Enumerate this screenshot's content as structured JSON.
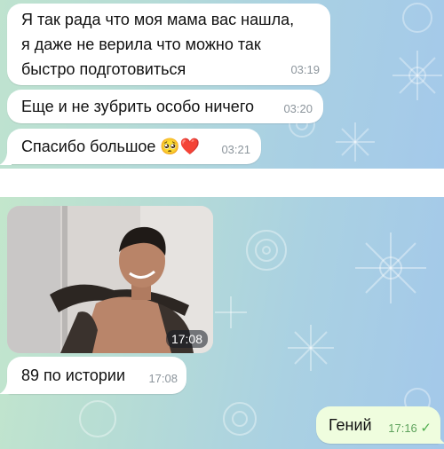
{
  "top_chat": {
    "messages": [
      {
        "lines": [
          "Я так рада что моя мама вас нашла,",
          "я даже не верила что можно так",
          "быстро подготовиться"
        ],
        "time": "03:19"
      },
      {
        "text": "Еще и не зубрить особо ничего",
        "time": "03:20"
      },
      {
        "text": "Спасибо большое",
        "emoji": "🥺❤️",
        "time": "03:21"
      }
    ]
  },
  "bottom_chat": {
    "gif": {
      "duration": "17:08"
    },
    "messages": [
      {
        "text": "89 по истории",
        "time": "17:08"
      }
    ],
    "outgoing": {
      "text": "Гений",
      "time": "17:16",
      "status_icon": "check-icon"
    }
  },
  "colors": {
    "incoming_bubble": "#ffffff",
    "outgoing_bubble": "#effdde",
    "timestamp": "#8c959c",
    "read_check": "#4fae4e",
    "wallpaper_start": "#bfe3cf",
    "wallpaper_end": "#a4c9ea"
  }
}
